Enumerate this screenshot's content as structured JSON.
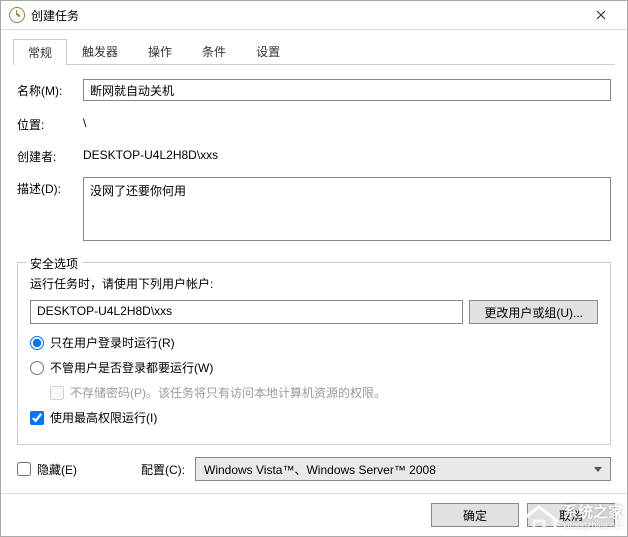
{
  "window": {
    "title": "创建任务"
  },
  "tabs": {
    "items": [
      {
        "label": "常规"
      },
      {
        "label": "触发器"
      },
      {
        "label": "操作"
      },
      {
        "label": "条件"
      },
      {
        "label": "设置"
      }
    ]
  },
  "general": {
    "name_label": "名称(M):",
    "name_value": "断网就自动关机",
    "location_label": "位置:",
    "location_value": "\\",
    "author_label": "创建者:",
    "author_value": "DESKTOP-U4L2H8D\\xxs",
    "description_label": "描述(D):",
    "description_value": "没网了还要你何用"
  },
  "security": {
    "legend": "安全选项",
    "run_as_label": "运行任务时，请使用下列用户帐户:",
    "account": "DESKTOP-U4L2H8D\\xxs",
    "change_user_btn": "更改用户或组(U)...",
    "radio_logged_on": "只在用户登录时运行(R)",
    "radio_any_user": "不管用户是否登录都要运行(W)",
    "no_store_pwd": "不存储密码(P)。该任务将只有访问本地计算机资源的权限。",
    "run_highest": "使用最高权限运行(I)"
  },
  "bottom": {
    "hidden_label": "隐藏(E)",
    "configure_label": "配置(C):",
    "configure_value": "Windows Vista™、Windows Server™ 2008"
  },
  "footer": {
    "ok": "确定",
    "cancel": "取消"
  },
  "watermark": {
    "line1": "系统之家",
    "line2": "xitongzhijia.net"
  }
}
